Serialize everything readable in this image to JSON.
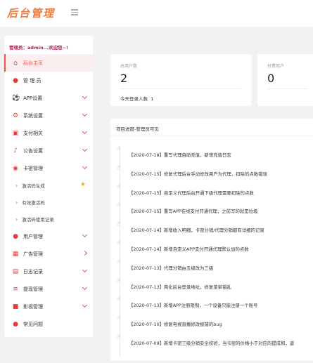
{
  "app": {
    "logo": "后台管理"
  },
  "sidebar": {
    "admin": "管理员：admin...欢迎您~!",
    "items": [
      {
        "label": "后台主页",
        "icon": "home-icon"
      },
      {
        "label": "管 理 员",
        "icon": "user-icon"
      },
      {
        "label": "APP设置",
        "icon": "football-icon"
      },
      {
        "label": "系统设置",
        "icon": "cogs-icon"
      },
      {
        "label": "支付相关",
        "icon": "money-icon"
      },
      {
        "label": "公告设置",
        "icon": "bell-icon"
      },
      {
        "label": "卡密管理",
        "icon": "globe-icon"
      },
      {
        "label": "激活码生成"
      },
      {
        "label": "有效激活码"
      },
      {
        "label": "激活码使用记录"
      },
      {
        "label": "用户管理",
        "icon": "users-icon"
      },
      {
        "label": "广告管理",
        "icon": "table-icon"
      },
      {
        "label": "日志记录",
        "icon": "print-icon"
      },
      {
        "label": "提现管理",
        "icon": "list-icon"
      },
      {
        "label": "影视管理",
        "icon": "video-icon"
      },
      {
        "label": "常见问题",
        "icon": "user-question-icon"
      }
    ]
  },
  "stats": {
    "total_users_label": "总用户数",
    "total_users": "2",
    "today_login_label": "今天登录人数",
    "today_login": "1",
    "paid_users_label": "付费用户",
    "paid_users": "0"
  },
  "progress": {
    "title": "项目进度-管理员可见",
    "entries": [
      "【2020-07-18】重写代理自助充值，新增充值日志",
      "【2020-07-15】修复代理后台手动修改用户为代理，扣除的点数错误",
      "【2020-07-15】自定义代理后台开通下级代理需要扣除的点数",
      "【2020-07-15】重写APP在线支付开通代理，之前写的就是垃圾",
      "【2020-07-14】新增收入明细，卡密分销/代理分销都有详细的记录",
      "【2020-07-14】新增自定义APP支付开通代理默认加的点数",
      "【2020-07-13】代理分销由五级改为三级",
      "【2020-07-13】简化后台登录地址，修复菜单错乱",
      "【2020-07-13】新增APP注册限制，一个设备只能注册一个账号",
      "【2020-07-10】修复电视直播修改报错的bug",
      "【2020-07-09】新增卡密三级分销安全校验，当卡密的价格小于对应的提成和，返"
    ]
  },
  "colors": {
    "accent": "#f0524c",
    "logo": "#f0783c",
    "admin": "#c2185b"
  }
}
